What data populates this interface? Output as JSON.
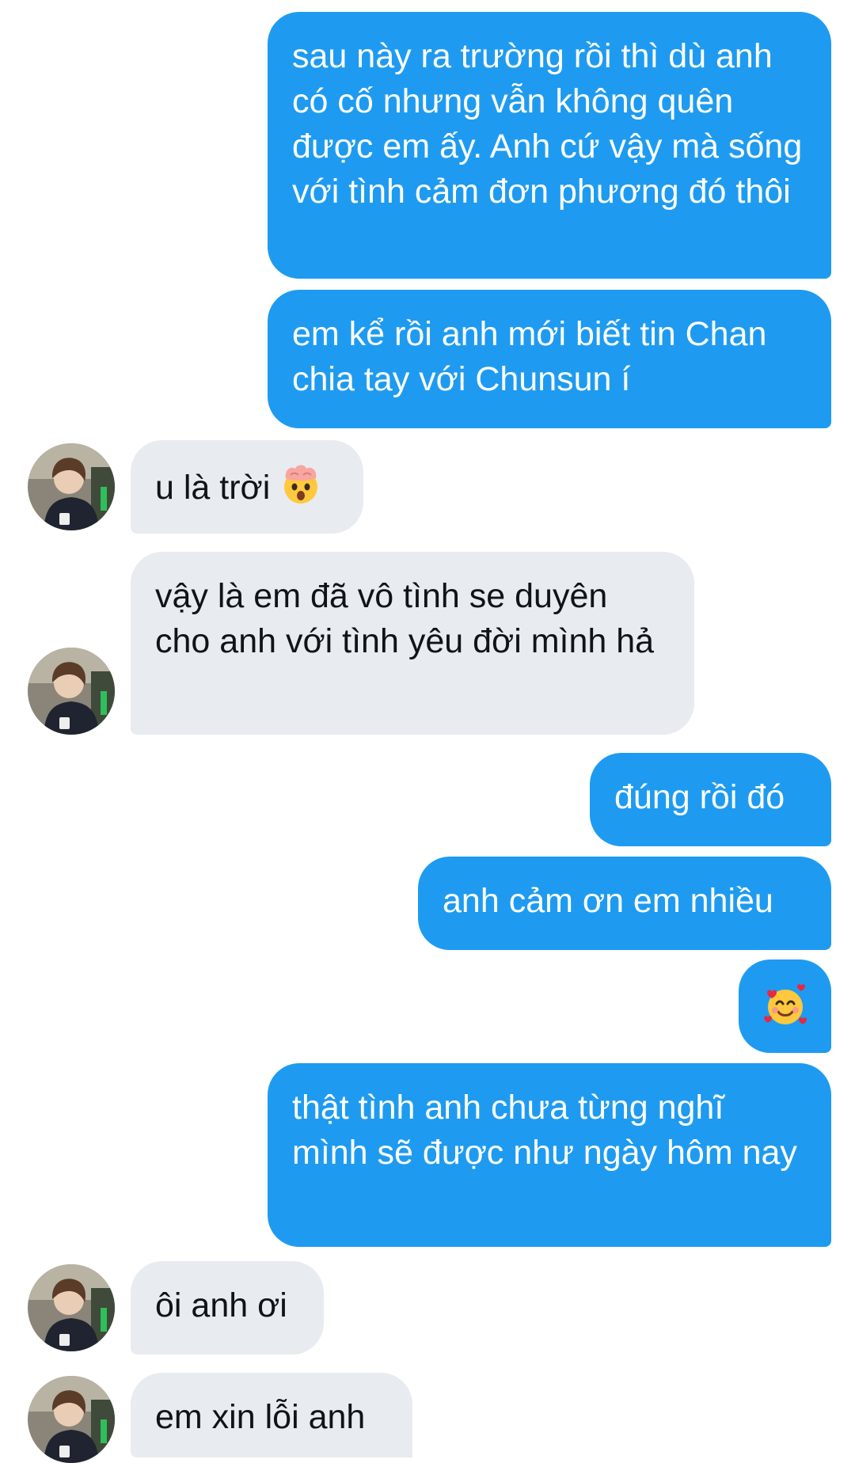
{
  "conversation": {
    "messages": [
      {
        "from": "me",
        "text": "sau này ra trường rồi thì dù anh có cố nhưng vẫn không quên được em ấy. Anh cứ vậy mà sống với tình cảm đơn phương đó thôi"
      },
      {
        "from": "me",
        "text": "em kể rồi anh mới biết tin Chan chia tay với Chunsun í"
      },
      {
        "from": "them",
        "text": "u là trời",
        "emoji": "exploding-head-emoji"
      },
      {
        "from": "them",
        "text": "vậy là em đã vô tình se duyên cho anh với tình yêu đời mình hả"
      },
      {
        "from": "me",
        "text": "đúng rồi đó"
      },
      {
        "from": "me",
        "text": "anh cảm ơn em nhiều"
      },
      {
        "from": "me",
        "emoji": "smiling-face-with-hearts-emoji"
      },
      {
        "from": "me",
        "text": "thật tình anh chưa từng nghĩ mình sẽ được như ngày hôm nay"
      },
      {
        "from": "them",
        "text": "ôi anh ơi"
      },
      {
        "from": "them",
        "text": "em xin lỗi anh"
      }
    ]
  },
  "colors": {
    "sent_bubble": "#1e9bf0",
    "received_bubble": "#e8ebef",
    "sent_text": "#ffffff",
    "received_text": "#0f1419"
  }
}
